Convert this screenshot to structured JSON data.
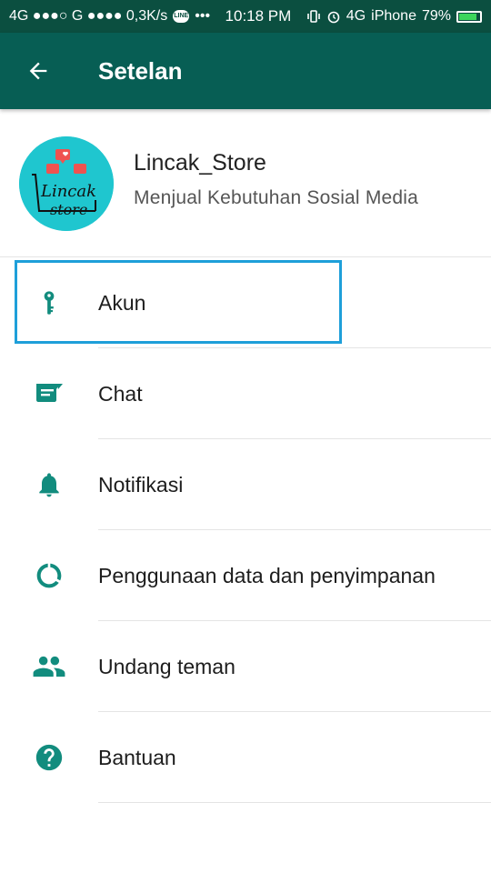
{
  "status_bar": {
    "left": "4G ●●●○ G ●●●● 0,3K/s",
    "line_icon": "LINE",
    "dots": "•••",
    "time": "10:18 PM",
    "network": "4G",
    "carrier": "iPhone",
    "battery": "79%",
    "battery_level": 0.79
  },
  "header": {
    "title": "Setelan",
    "back_icon": "arrow-back-icon"
  },
  "profile": {
    "name": "Lincak_Store",
    "status": "Menjual Kebutuhan Sosial Media",
    "avatar_text_1": "Lincak",
    "avatar_text_2": "store"
  },
  "menu": [
    {
      "label": "Akun",
      "icon": "key-icon"
    },
    {
      "label": "Chat",
      "icon": "chat-icon"
    },
    {
      "label": "Notifikasi",
      "icon": "bell-icon"
    },
    {
      "label": "Penggunaan data dan penyimpanan",
      "icon": "data-usage-icon"
    },
    {
      "label": "Undang teman",
      "icon": "people-icon"
    },
    {
      "label": "Bantuan",
      "icon": "help-icon"
    }
  ],
  "colors": {
    "status_bar": "#0b4f40",
    "header": "#075e54",
    "icon": "#128c7e",
    "highlight": "#1e9fd9",
    "avatar_bg": "#1fc6cf"
  }
}
